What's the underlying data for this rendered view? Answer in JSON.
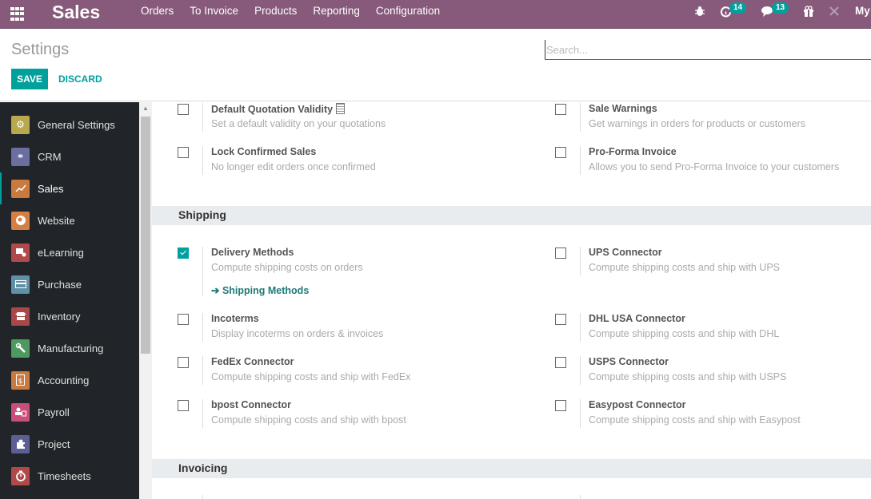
{
  "navbar": {
    "app_name": "Sales",
    "menu": [
      "Orders",
      "To Invoice",
      "Products",
      "Reporting",
      "Configuration"
    ],
    "activity_count": "14",
    "messages_count": "13",
    "user_label": "My"
  },
  "control_panel": {
    "title": "Settings",
    "search_placeholder": "Search...",
    "save_label": "SAVE",
    "discard_label": "DISCARD"
  },
  "sidebar": {
    "items": [
      {
        "label": "General Settings",
        "icon": "gear-icon",
        "color": "#b8a84e"
      },
      {
        "label": "CRM",
        "icon": "handshake-icon",
        "color": "#6a6fa0"
      },
      {
        "label": "Sales",
        "icon": "chart-icon",
        "color": "#c97a3f",
        "active": true
      },
      {
        "label": "Website",
        "icon": "globe-icon",
        "color": "#d67f43"
      },
      {
        "label": "eLearning",
        "icon": "elearning-icon",
        "color": "#b04a4a"
      },
      {
        "label": "Purchase",
        "icon": "credit-card-icon",
        "color": "#5f90a8"
      },
      {
        "label": "Inventory",
        "icon": "box-icon",
        "color": "#a84848"
      },
      {
        "label": "Manufacturing",
        "icon": "wrench-icon",
        "color": "#4e9a5e"
      },
      {
        "label": "Accounting",
        "icon": "invoice-dollar-icon",
        "color": "#c97a3f"
      },
      {
        "label": "Payroll",
        "icon": "payroll-icon",
        "color": "#c94f7a"
      },
      {
        "label": "Project",
        "icon": "puzzle-icon",
        "color": "#5c5f94"
      },
      {
        "label": "Timesheets",
        "icon": "stopwatch-icon",
        "color": "#b04a4a"
      }
    ]
  },
  "settings": {
    "quotations": [
      {
        "title": "Default Quotation Validity",
        "desc": "Set a default validity on your quotations",
        "checked": false
      },
      {
        "title": "Sale Warnings",
        "desc": "Get warnings in orders for products or customers",
        "checked": false
      },
      {
        "title": "Lock Confirmed Sales",
        "desc": "No longer edit orders once confirmed",
        "checked": false
      },
      {
        "title": "Pro-Forma Invoice",
        "desc": "Allows you to send Pro-Forma Invoice to your customers",
        "checked": false
      }
    ],
    "shipping_title": "Shipping",
    "shipping": [
      {
        "title": "Delivery Methods",
        "desc": "Compute shipping costs on orders",
        "checked": true,
        "link": "Shipping Methods"
      },
      {
        "title": "UPS Connector",
        "desc": "Compute shipping costs and ship with UPS",
        "checked": false
      },
      {
        "title": "Incoterms",
        "desc": "Display incoterms on orders & invoices",
        "checked": false
      },
      {
        "title": "DHL USA Connector",
        "desc": "Compute shipping costs and ship with DHL",
        "checked": false
      },
      {
        "title": "FedEx Connector",
        "desc": "Compute shipping costs and ship with FedEx",
        "checked": false
      },
      {
        "title": "USPS Connector",
        "desc": "Compute shipping costs and ship with USPS",
        "checked": false
      },
      {
        "title": "bpost Connector",
        "desc": "Compute shipping costs and ship with bpost",
        "checked": false
      },
      {
        "title": "Easypost Connector",
        "desc": "Compute shipping costs and ship with Easypost",
        "checked": false
      }
    ],
    "invoicing_title": "Invoicing"
  },
  "colors": {
    "navbar": "#875a7b",
    "accent": "#00a09d",
    "sidebar": "#212529",
    "section_header": "#e9ecef"
  }
}
